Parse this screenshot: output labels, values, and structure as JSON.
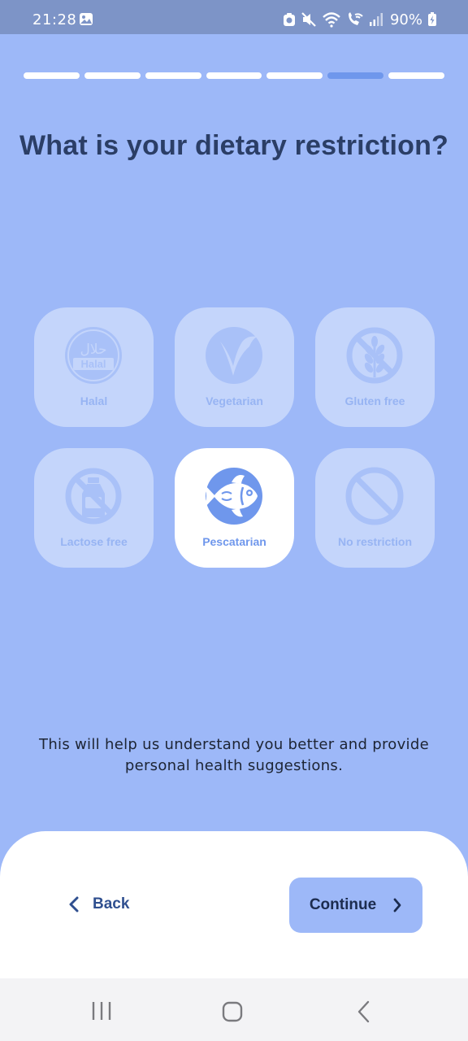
{
  "status_bar": {
    "time": "21:28",
    "battery_text": "90%",
    "icons": [
      "gallery-icon",
      "camera-notification-icon",
      "mute-icon",
      "wifi-icon",
      "wifi-calling-icon",
      "signal-icon",
      "battery-charging-icon"
    ]
  },
  "progress": {
    "total_steps": 7,
    "current_step": 6
  },
  "question": {
    "title": "What is your dietary restriction?"
  },
  "options": [
    {
      "label": "Halal",
      "icon": "halal-icon",
      "icon_text_top": "حلال",
      "icon_text_bottom": "Halal",
      "selected": false
    },
    {
      "label": "Vegetarian",
      "icon": "leaf-icon",
      "selected": false
    },
    {
      "label": "Gluten free",
      "icon": "no-wheat-icon",
      "selected": false
    },
    {
      "label": "Lactose free",
      "icon": "no-milk-bottle-icon",
      "selected": false
    },
    {
      "label": "Pescatarian",
      "icon": "fish-icon",
      "selected": true
    },
    {
      "label": "No restriction",
      "icon": "prohibited-icon",
      "selected": false
    }
  ],
  "helper_text": "This will help us understand you better and provide personal health suggestions.",
  "footer": {
    "back_label": "Back",
    "continue_label": "Continue"
  },
  "nav_bar": {
    "icons": [
      "recents-icon",
      "home-icon",
      "back-icon"
    ]
  },
  "colors": {
    "background": "#9db8f8",
    "accent": "#6f97ec",
    "tile_unselected": "#c4d5fb",
    "tile_selected": "#ffffff",
    "title": "#2b3e66"
  }
}
